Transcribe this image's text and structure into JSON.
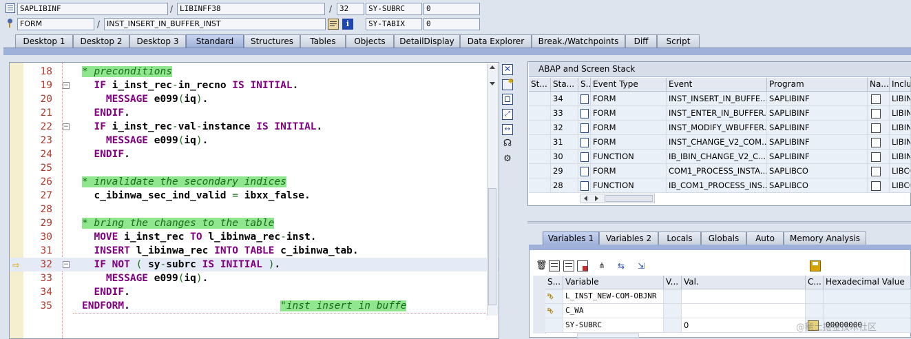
{
  "header": {
    "program_field": "SAPLIBINF",
    "include_field": "LIBINFF38",
    "line_field": "32",
    "sysvar1_name": "SY-SUBRC",
    "sysvar1_value": "0",
    "type_field": "FORM",
    "event_field": "INST_INSERT_IN_BUFFER_INST",
    "sysvar2_name": "SY-TABIX",
    "sysvar2_value": "0",
    "slash": "/"
  },
  "tabs": [
    "Desktop 1",
    "Desktop 2",
    "Desktop 3",
    "Standard",
    "Structures",
    "Tables",
    "Objects",
    "DetailDisplay",
    "Data Explorer",
    "Break./Watchpoints",
    "Diff",
    "Script"
  ],
  "active_tab": "Standard",
  "code": {
    "lines": [
      {
        "n": "18",
        "fold": false,
        "code": "<span class=\"cmt\">* preconditions</span>"
      },
      {
        "n": "19",
        "fold": true,
        "code": "  <span class=\"kw\">IF</span> <span class=\"id\">i_inst_rec</span><span class=\"ar\">-</span><span class=\"id\">in_recno</span> <span class=\"kw\">IS INITIAL</span><span class=\"id\">.</span>"
      },
      {
        "n": "20",
        "fold": false,
        "code": "    <span class=\"kw\">MESSAGE</span> <span class=\"id\">e099</span><span class=\"ar\">(</span><span class=\"id\">iq</span><span class=\"ar\">)</span><span class=\"id\">.</span>"
      },
      {
        "n": "21",
        "fold": false,
        "code": "  <span class=\"kw\">ENDIF</span><span class=\"id\">.</span>"
      },
      {
        "n": "22",
        "fold": true,
        "code": "  <span class=\"kw\">IF</span> <span class=\"id\">i_inst_rec</span><span class=\"ar\">-</span><span class=\"id\">val</span><span class=\"ar\">-</span><span class=\"id\">instance</span> <span class=\"kw\">IS INITIAL</span><span class=\"id\">.</span>"
      },
      {
        "n": "23",
        "fold": false,
        "code": "    <span class=\"kw\">MESSAGE</span> <span class=\"id\">e099</span><span class=\"ar\">(</span><span class=\"id\">iq</span><span class=\"ar\">)</span><span class=\"id\">.</span>"
      },
      {
        "n": "24",
        "fold": false,
        "code": "  <span class=\"kw\">ENDIF</span><span class=\"id\">.</span>"
      },
      {
        "n": "25",
        "fold": false,
        "code": ""
      },
      {
        "n": "26",
        "fold": false,
        "code": "<span class=\"cmt\">* invalidate the secondary indices</span>"
      },
      {
        "n": "27",
        "fold": false,
        "code": "  <span class=\"id\">c_ibinwa_sec_ind_valid</span> <span class=\"ar\">=</span> <span class=\"id\">ibxx_false</span><span class=\"id\">.</span>"
      },
      {
        "n": "28",
        "fold": false,
        "code": ""
      },
      {
        "n": "29",
        "fold": false,
        "code": "<span class=\"cmt\">* bring the changes to the table</span>"
      },
      {
        "n": "30",
        "fold": false,
        "code": "  <span class=\"kw\">MOVE</span> <span class=\"id\">i_inst_rec</span> <span class=\"kw\">TO</span> <span class=\"id\">l_ibinwa_rec</span><span class=\"ar\">-</span><span class=\"id\">inst</span><span class=\"id\">.</span>"
      },
      {
        "n": "31",
        "fold": false,
        "code": "  <span class=\"kw\">INSERT</span> <span class=\"id\">l_ibinwa_rec</span> <span class=\"kw\">INTO TABLE</span> <span class=\"id\">c_ibinwa_tab</span><span class=\"id\">.</span>"
      },
      {
        "n": "32",
        "fold": true,
        "current": true,
        "code": "  <span class=\"kw\">IF NOT</span> <span class=\"ar\">(</span> <span class=\"id\">sy</span><span class=\"ar\">-</span><span class=\"id\">subrc</span> <span class=\"kw\">IS INITIAL</span> <span class=\"ar\">)</span><span class=\"id\">.</span>"
      },
      {
        "n": "33",
        "fold": false,
        "code": "    <span class=\"kw\">MESSAGE</span> <span class=\"id\">e099</span><span class=\"ar\">(</span><span class=\"id\">iq</span><span class=\"ar\">)</span><span class=\"id\">.</span>"
      },
      {
        "n": "34",
        "fold": false,
        "code": "  <span class=\"kw\">ENDIF</span><span class=\"id\">.</span>"
      },
      {
        "n": "35",
        "fold": false,
        "code": "<span class=\"kw\">ENDFORM</span><span class=\"id\">.</span>                         <span class=\"cmt\">\"inst insert in buffe</span>"
      }
    ]
  },
  "stack": {
    "title": "ABAP and Screen Stack",
    "columns": [
      "St...",
      "Sta...",
      "S...",
      "Event Type",
      "Event",
      "Program",
      "Na...",
      "Inclu"
    ],
    "rows": [
      {
        "level": "34",
        "etype": "FORM",
        "event": "INST_INSERT_IN_BUFFE...",
        "program": "SAPLIBINF",
        "incl": "LIBIN",
        "current": true
      },
      {
        "level": "33",
        "etype": "FORM",
        "event": "INST_ENTER_IN_BUFFER...",
        "program": "SAPLIBINF",
        "incl": "LIBIN"
      },
      {
        "level": "32",
        "etype": "FORM",
        "event": "INST_MODIFY_WBUFFER...",
        "program": "SAPLIBINF",
        "incl": "LIBIN"
      },
      {
        "level": "31",
        "etype": "FORM",
        "event": "INST_CHANGE_V2_COM...",
        "program": "SAPLIBINF",
        "incl": "LIBIN"
      },
      {
        "level": "30",
        "etype": "FUNCTION",
        "event": "IB_IBIN_CHANGE_V2_C...",
        "program": "SAPLIBINF",
        "incl": "LIBIN"
      },
      {
        "level": "29",
        "etype": "FORM",
        "event": "COM1_PROCESS_INSTA...",
        "program": "SAPLIBCO",
        "incl": "LIBCO"
      },
      {
        "level": "28",
        "etype": "FUNCTION",
        "event": "IB_COM1_PROCESS_INS...",
        "program": "SAPLIBCO",
        "incl": "LIBCO"
      }
    ]
  },
  "var_tabs": [
    "Variables 1",
    "Variables 2",
    "Locals",
    "Globals",
    "Auto",
    "Memory Analysis"
  ],
  "vars": {
    "columns": [
      "S...",
      "Variable",
      "V...",
      "Val.",
      "C...",
      "Hexadecimal Value"
    ],
    "rows": [
      {
        "name": "L_INST_NEW-COM-OBJNR",
        "value": "",
        "hex": ""
      },
      {
        "name": "C_WA",
        "value": "",
        "hex": ""
      },
      {
        "name": "SY-SUBRC",
        "value": "0",
        "hex": "00000000"
      }
    ]
  },
  "watermark": "@稀土掘金技术社区"
}
